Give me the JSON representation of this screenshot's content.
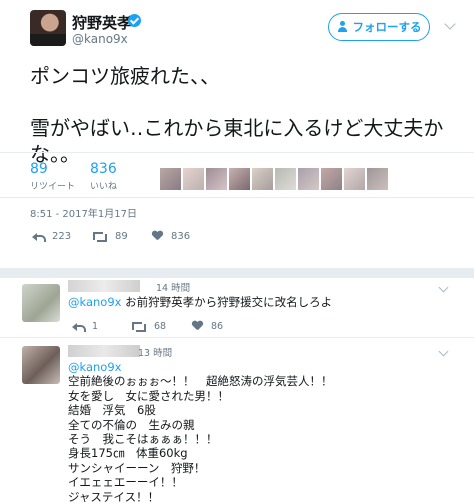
{
  "tweet": {
    "user_name": "狩野英孝",
    "user_handle": "@kano9x",
    "follow_label": "フォローする",
    "text_lines": [
      "ポンコツ旅疲れた、、",
      "",
      "雪がやばい‥これから東北に入るけど大丈夫か",
      "な。。"
    ],
    "retweets_count": "89",
    "retweets_label": "リツイート",
    "likes_count": "836",
    "likes_label": "いいね",
    "timestamp": "8:51 - 2017年1月17日",
    "action_reply_count": "223",
    "action_retweet_count": "89",
    "action_like_count": "836"
  },
  "replies": [
    {
      "time": "14 時間",
      "mention": "@kano9x",
      "text": " お前狩野英孝から狩野援交に改名しろよ",
      "reply_count": "1",
      "retweet_count": "68",
      "like_count": "86"
    },
    {
      "time": "13 時間",
      "mention": "@kano9x",
      "lines": [
        "空前絶後のぉぉぉ～！！　超絶怒涛の浮気芸人！！",
        "女を愛し　女に愛された男！！",
        "結婚　浮気　6股",
        "全ての不倫の　生みの親",
        "そう　我こそはぁぁぁ！！！",
        "身長175㎝　体重60kg",
        "サンシャイーーン　狩野！",
        "イエェェエーーイ！！",
        "ジャステイス！！"
      ]
    }
  ],
  "colors": {
    "accent": "#1da1f2",
    "muted": "#657786",
    "divider": "#e6ecf0"
  },
  "icons": [
    "verified-icon",
    "follow-person-icon",
    "chevron-down-icon",
    "reply-icon",
    "retweet-icon",
    "like-icon"
  ]
}
